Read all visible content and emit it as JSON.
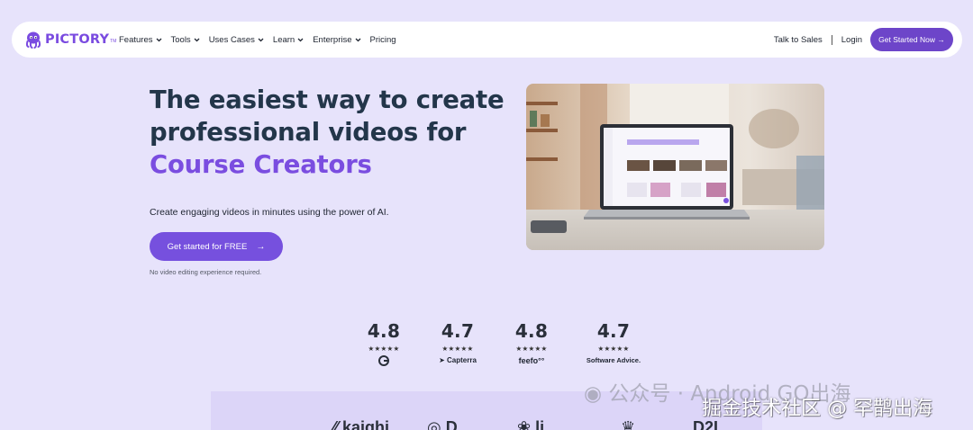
{
  "brand": {
    "name": "PICTORY",
    "tm": "TM",
    "accent_color": "#7a4be0"
  },
  "nav": {
    "menu": [
      {
        "label": "Features",
        "has_dropdown": true
      },
      {
        "label": "Tools",
        "has_dropdown": true
      },
      {
        "label": "Uses Cases",
        "has_dropdown": true
      },
      {
        "label": "Learn",
        "has_dropdown": true
      },
      {
        "label": "Enterprise",
        "has_dropdown": true
      },
      {
        "label": "Pricing",
        "has_dropdown": false
      }
    ],
    "talk_to_sales": "Talk to Sales",
    "login": "Login",
    "cta": "Get Started Now →"
  },
  "hero": {
    "title_line1": "The easiest way to create",
    "title_line2": "professional videos for",
    "title_accent": "Course Creators",
    "subtitle": "Create engaging videos in minutes using the power of AI.",
    "cta_label": "Get started for FREE",
    "cta_arrow": "→",
    "note": "No video editing experience required."
  },
  "ratings": [
    {
      "score": "4.8",
      "stars": "★★★★★",
      "brand": "G2",
      "icon": "g2-logo-icon"
    },
    {
      "score": "4.7",
      "stars": "★★★★★",
      "brand": "Capterra",
      "icon": "capterra-logo-icon"
    },
    {
      "score": "4.8",
      "stars": "★★★★★",
      "brand": "feefo",
      "icon": "feefo-logo-icon"
    },
    {
      "score": "4.7",
      "stars": "★★★★★",
      "brand": "Software Advice.",
      "icon": "software-advice-logo-icon"
    }
  ],
  "watermark": {
    "line1": "公众号 · Android GO出海",
    "line2": "掘金技术社区 @ 罕鹊出海"
  },
  "colors": {
    "background": "#e7e3fb",
    "primary": "#6d45c9",
    "heading": "#23364a"
  }
}
